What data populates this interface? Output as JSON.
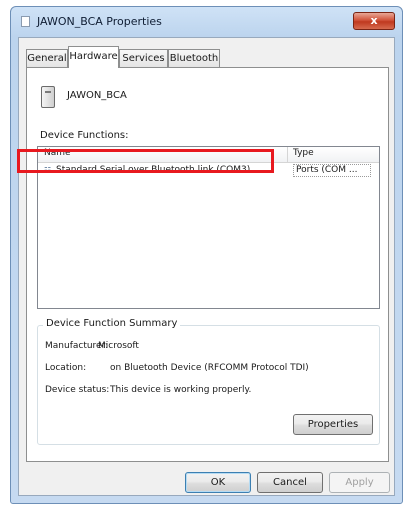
{
  "window": {
    "title": "JAWON_BCA Properties",
    "close_label": "x"
  },
  "tabs": [
    {
      "label": "General"
    },
    {
      "label": "Hardware"
    },
    {
      "label": "Services"
    },
    {
      "label": "Bluetooth"
    }
  ],
  "active_tab": "Hardware",
  "device": {
    "name": "JAWON_BCA",
    "icon": "device-icon"
  },
  "device_functions": {
    "label": "Device Functions:",
    "columns": [
      "Name",
      "Type"
    ],
    "rows": [
      {
        "name": "Standard Serial over Bluetooth link (COM3)",
        "type": "Ports (COM ...",
        "icon": "serial-port-icon"
      }
    ]
  },
  "summary": {
    "title": "Device Function Summary",
    "manufacturer_label": "Manufacturer:",
    "manufacturer_value": "Microsoft",
    "location_label": "Location:",
    "location_value": "on Bluetooth Device (RFCOMM Protocol TDI)",
    "status_label": "Device status:",
    "status_value": "This device is working properly."
  },
  "buttons": {
    "properties": "Properties",
    "ok": "OK",
    "cancel": "Cancel",
    "apply": "Apply"
  },
  "colors": {
    "highlight": "#e8191f",
    "close_button": "#c0391f"
  }
}
